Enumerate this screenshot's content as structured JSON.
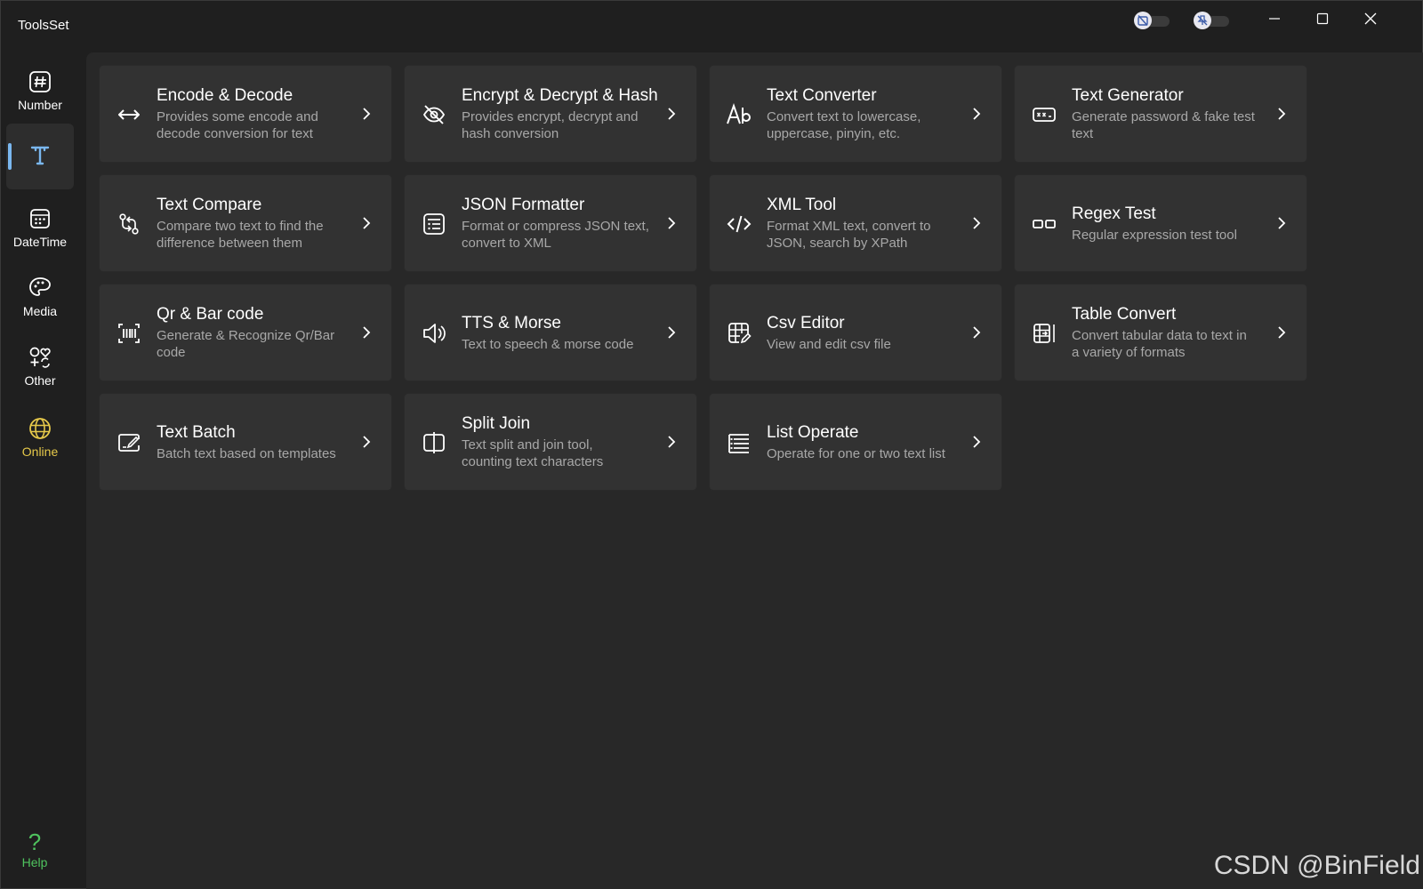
{
  "window": {
    "title": "ToolsSet"
  },
  "title_bar": {
    "toggle_1_icon": "calendar-off-icon",
    "toggle_2_icon": "pin-off-icon",
    "minimize_icon": "minimize-icon",
    "maximize_icon": "maximize-icon",
    "close_icon": "close-icon"
  },
  "sidebar": {
    "items": [
      {
        "label": "Number",
        "icon": "hash-icon",
        "selected": false
      },
      {
        "label": "",
        "icon": "text-icon",
        "selected": true
      },
      {
        "label": "DateTime",
        "icon": "calendar-icon",
        "selected": false
      },
      {
        "label": "Media",
        "icon": "palette-icon",
        "selected": false
      },
      {
        "label": "Other",
        "icon": "shapes-icon",
        "selected": false
      },
      {
        "label": "Online",
        "icon": "globe-icon",
        "selected": false
      }
    ],
    "help_label": "Help",
    "help_icon": "question-icon",
    "accent_color": "#7ab7ef",
    "online_color": "#e6c94a",
    "help_color": "#4fc35e"
  },
  "tools": [
    {
      "title": "Encode & Decode",
      "desc_1": "Provides some encode and",
      "desc_2": "decode conversion for text",
      "icon": "arrows-horizontal-icon"
    },
    {
      "title": "Encrypt & Decrypt & Hash",
      "desc_1": "Provides encrypt, decrypt and",
      "desc_2": "hash conversion",
      "icon": "eye-off-icon"
    },
    {
      "title": "Text Converter",
      "desc_1": "Convert text to lowercase,",
      "desc_2": "uppercase, pinyin, etc.",
      "icon": "font-case-icon"
    },
    {
      "title": "Text Generator",
      "desc_1": "Generate password & fake test",
      "desc_2": "text",
      "icon": "password-field-icon"
    },
    {
      "title": "Text Compare",
      "desc_1": "Compare two text to find the",
      "desc_2": "difference between them",
      "icon": "compare-icon"
    },
    {
      "title": "JSON Formatter",
      "desc_1": "Format or compress JSON text,",
      "desc_2": "convert to XML",
      "icon": "document-list-icon"
    },
    {
      "title": "XML Tool",
      "desc_1": "Format XML text, convert to",
      "desc_2": "JSON, search by XPath",
      "icon": "code-icon"
    },
    {
      "title": "Regex Test",
      "desc_1": "Regular expression test tool",
      "desc_2": "",
      "icon": "regex-icon"
    },
    {
      "title": "Qr & Bar code",
      "desc_1": "Generate & Recognize Qr/Bar",
      "desc_2": "code",
      "icon": "barcode-scan-icon"
    },
    {
      "title": "TTS & Morse",
      "desc_1": "Text to speech & morse code",
      "desc_2": "",
      "icon": "speaker-icon"
    },
    {
      "title": "Csv Editor",
      "desc_1": "View and edit csv file",
      "desc_2": "",
      "icon": "table-edit-icon"
    },
    {
      "title": "Table Convert",
      "desc_1": "Convert tabular data to text in",
      "desc_2": "a variety of formats",
      "icon": "table-convert-icon"
    },
    {
      "title": "Text Batch",
      "desc_1": "Batch text based on templates",
      "desc_2": "",
      "icon": "text-edit-icon"
    },
    {
      "title": "Split Join",
      "desc_1": "Text split and join tool,",
      "desc_2": "counting text characters",
      "icon": "split-icon"
    },
    {
      "title": "List Operate",
      "desc_1": "Operate for one or two text list",
      "desc_2": "",
      "icon": "list-icon"
    }
  ],
  "chevron_icon": "chevron-right-icon",
  "watermark": "CSDN @BinField"
}
